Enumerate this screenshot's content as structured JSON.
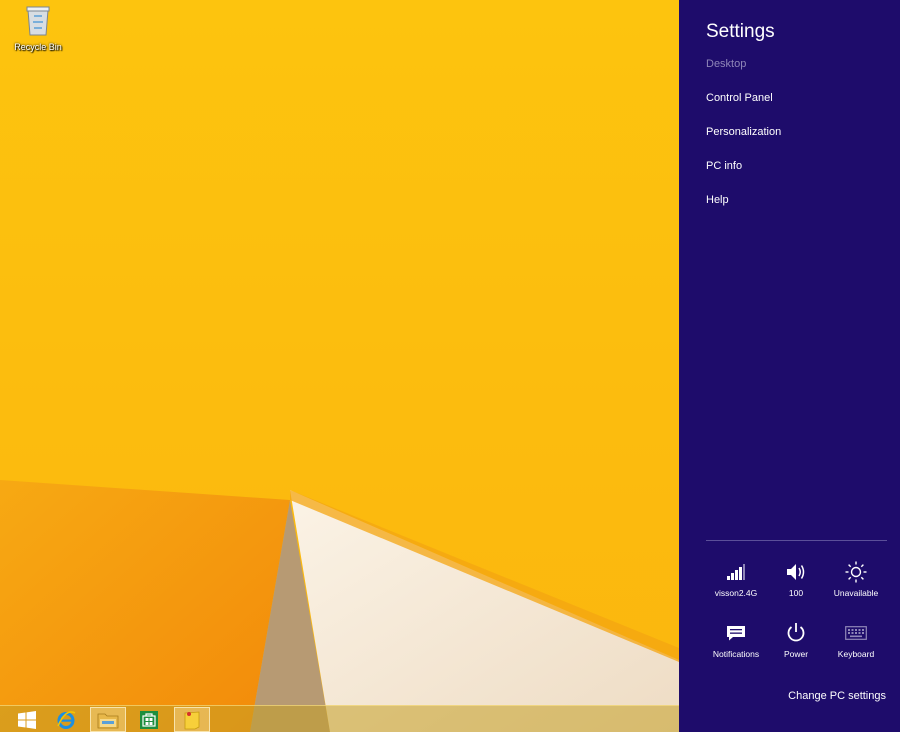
{
  "desktop": {
    "recycle_bin_label": "Recycle Bin"
  },
  "taskbar": {
    "items": [
      {
        "name": "start-button",
        "icon": "windows-logo-icon"
      },
      {
        "name": "internet-explorer",
        "icon": "internet-explorer-icon"
      },
      {
        "name": "file-explorer",
        "icon": "folder-icon"
      },
      {
        "name": "store",
        "icon": "store-icon"
      },
      {
        "name": "sticky-notes",
        "icon": "sticky-note-icon"
      }
    ]
  },
  "charm": {
    "title": "Settings",
    "subtitle": "Desktop",
    "items": [
      "Control Panel",
      "Personalization",
      "PC info",
      "Help"
    ],
    "quick": {
      "network_label": "visson2.4G",
      "volume_label": "100",
      "brightness_label": "Unavailable",
      "notifications_label": "Notifications",
      "power_label": "Power",
      "keyboard_label": "Keyboard"
    },
    "change_pc_settings": "Change PC settings"
  },
  "colors": {
    "charm_bg": "#1e0c6b",
    "wallpaper_yellow": "#fcbe0c",
    "wallpaper_orange": "#f59a0c",
    "wallpaper_cream": "#f3e6d2"
  }
}
